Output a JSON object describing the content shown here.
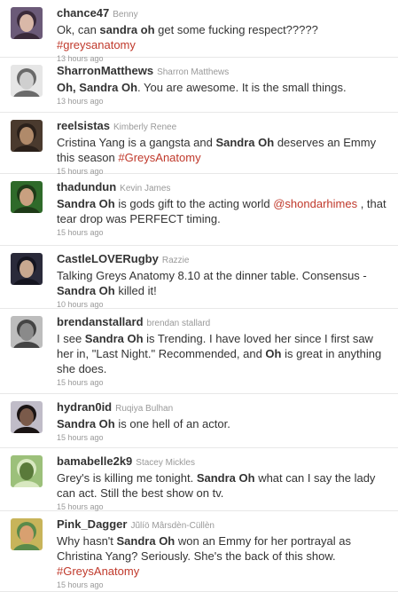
{
  "tweets": [
    {
      "screen_name": "chance47",
      "real_name": "Benny",
      "segments": [
        {
          "t": "Ok, can "
        },
        {
          "t": "sandra oh",
          "b": true
        },
        {
          "t": " get some fucking respect????? "
        },
        {
          "t": "#greysanatomy",
          "link": true
        }
      ],
      "time": "13 hours ago",
      "avatar": {
        "bg": "#6b5a78",
        "fg": "#d9b8a8",
        "hair": "#3a2a3a"
      }
    },
    {
      "screen_name": "SharronMatthews",
      "real_name": "Sharron Matthews",
      "segments": [
        {
          "t": "Oh, Sandra Oh",
          "b": true
        },
        {
          "t": ". You are awesome. It is the small things."
        }
      ],
      "time": "13 hours ago",
      "avatar": {
        "bg": "#e6e6e6",
        "fg": "#cfcfcf",
        "hair": "#6a6a6a"
      }
    },
    {
      "screen_name": "reelsistas",
      "real_name": "Kimberly Renee",
      "segments": [
        {
          "t": "Cristina Yang is a gangsta and "
        },
        {
          "t": "Sandra Oh",
          "b": true
        },
        {
          "t": " deserves an Emmy this season "
        },
        {
          "t": "#GreysAnatomy",
          "link": true
        }
      ],
      "time": "15 hours ago",
      "avatar": {
        "bg": "#4a3a2e",
        "fg": "#b08a6a",
        "hair": "#2a201a"
      }
    },
    {
      "screen_name": "thadundun",
      "real_name": "Kevin James",
      "segments": [
        {
          "t": "Sandra Oh",
          "b": true
        },
        {
          "t": " is gods gift to the acting world "
        },
        {
          "t": "@shondarhimes",
          "link": true
        },
        {
          "t": " , that tear drop was PERFECT timing."
        }
      ],
      "time": "15 hours ago",
      "avatar": {
        "bg": "#2f6a2a",
        "fg": "#c9a080",
        "hair": "#1e3a18"
      }
    },
    {
      "screen_name": "CastleLOVERugby",
      "real_name": "Razzie",
      "segments": [
        {
          "t": "Talking Greys Anatomy 8.10 at the dinner table. Consensus - "
        },
        {
          "t": "Sandra Oh",
          "b": true
        },
        {
          "t": " killed it!"
        }
      ],
      "time": "10 hours ago",
      "avatar": {
        "bg": "#2a2a3a",
        "fg": "#c8a890",
        "hair": "#151520"
      }
    },
    {
      "screen_name": "brendanstallard",
      "real_name": "brendan stallard",
      "segments": [
        {
          "t": "I see "
        },
        {
          "t": "Sandra Oh",
          "b": true
        },
        {
          "t": " is Trending. I have loved her since I first saw her in, \"Last Night.\" Recommended, and "
        },
        {
          "t": "Oh",
          "b": true
        },
        {
          "t": " is great in anything she does."
        }
      ],
      "time": "15 hours ago",
      "avatar": {
        "bg": "#bdbdbd",
        "fg": "#8a8a8a",
        "hair": "#444444"
      }
    },
    {
      "screen_name": "hydran0id",
      "real_name": "Ruqiya Bulhan",
      "segments": [
        {
          "t": "Sandra Oh",
          "b": true
        },
        {
          "t": " is one hell of an actor."
        }
      ],
      "time": "15 hours ago",
      "avatar": {
        "bg": "#c0bcc8",
        "fg": "#7a5a4a",
        "hair": "#1a1414"
      }
    },
    {
      "screen_name": "bamabelle2k9",
      "real_name": "Stacey Mickles",
      "segments": [
        {
          "t": "Grey's is killing me tonight. "
        },
        {
          "t": "Sandra Oh",
          "b": true
        },
        {
          "t": " what can I say the lady can act. Still the best show on tv."
        }
      ],
      "time": "15 hours ago",
      "avatar": {
        "bg": "#9cc07a",
        "fg": "#5a7a3a",
        "hair": "#d8e8c0"
      }
    },
    {
      "screen_name": "Pink_Dagger",
      "real_name": "Jũlíö Mârsdèn-Cüllèn",
      "segments": [
        {
          "t": "Why hasn't "
        },
        {
          "t": "Sandra Oh",
          "b": true
        },
        {
          "t": " won an Emmy for her portrayal as Christina Yang? Seriously. She's the back of this show. "
        },
        {
          "t": "#GreysAnatomy",
          "link": true
        }
      ],
      "time": "15 hours ago",
      "avatar": {
        "bg": "#c8b45a",
        "fg": "#d8a070",
        "hair": "#5a8a4a"
      }
    }
  ]
}
